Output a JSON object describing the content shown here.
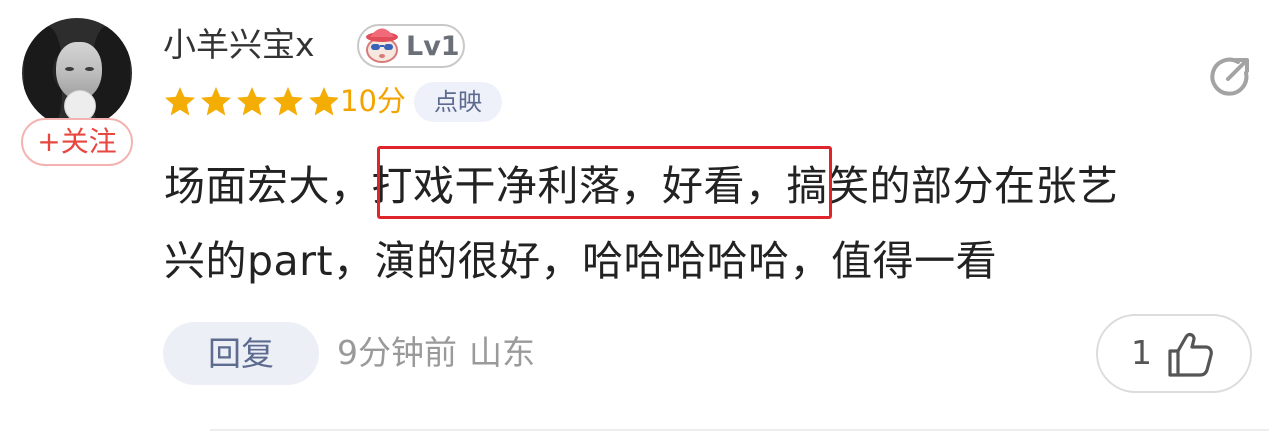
{
  "user": {
    "name": "小羊兴宝x",
    "level": "Lv1",
    "follow_label": "+关注"
  },
  "rating": {
    "stars": 5,
    "score_text": "10分",
    "source_tag": "点映"
  },
  "comment": {
    "line1_prefix": "场面宏大，",
    "line1_highlight": "打戏干净利落，好看，",
    "line1_suffix": "搞笑的部分在张艺",
    "line2": "兴的part，演的很好，哈哈哈哈哈，值得一看"
  },
  "footer": {
    "reply_label": "回复",
    "time": "9分钟前",
    "location": "山东",
    "like_count": "1"
  },
  "colors": {
    "star": "#f4ad05",
    "score": "#f3a400",
    "highlight_border": "#e0242b",
    "follow": "#e7473f",
    "reply_bg": "#eceff6"
  },
  "icons": {
    "share": "share-icon",
    "like": "thumbs-up-icon",
    "level": "level-avatar-icon",
    "star": "star-icon"
  }
}
